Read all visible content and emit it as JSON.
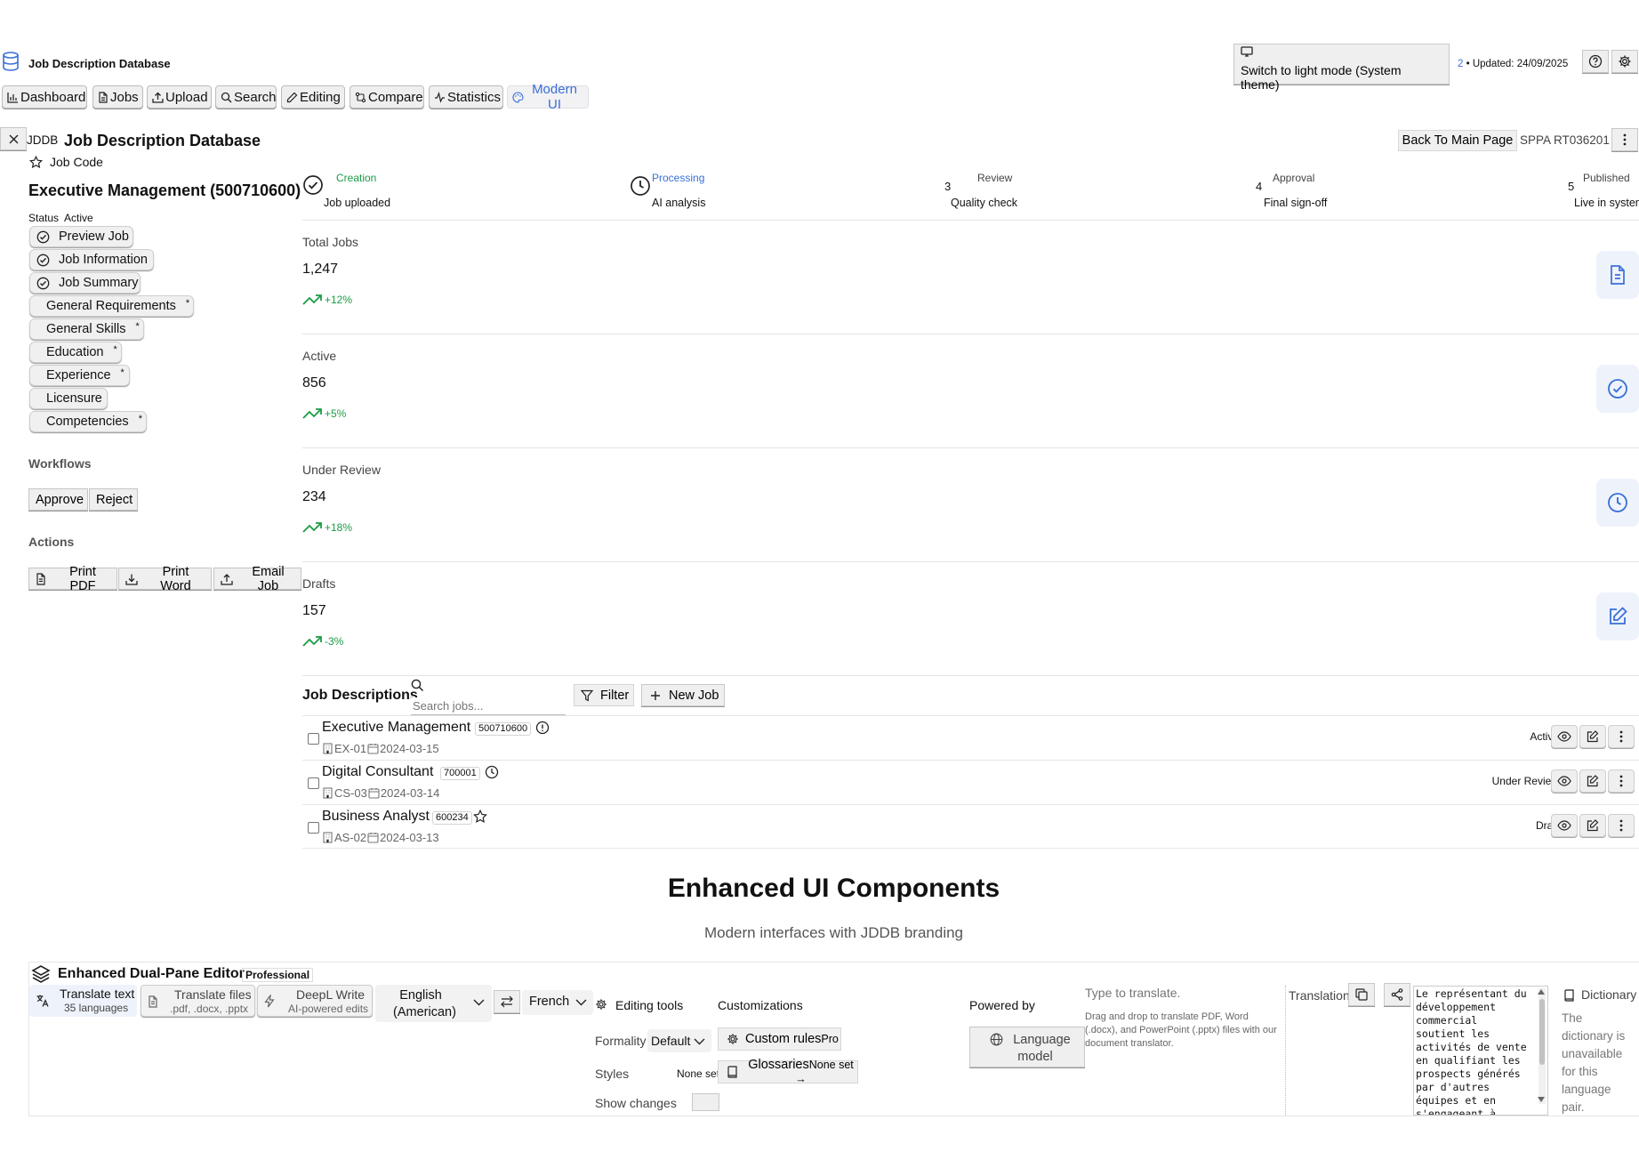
{
  "app": {
    "title": "Job Description Database"
  },
  "topbar": {
    "theme_label": "Switch to light mode (System theme)",
    "update_count": "2",
    "update_text": " • Updated: 24/09/2025"
  },
  "nav": [
    {
      "label": "Dashboard",
      "icon": "bar-chart-icon"
    },
    {
      "label": "Jobs",
      "icon": "file-icon"
    },
    {
      "label": "Upload",
      "icon": "upload-icon"
    },
    {
      "label": "Search",
      "icon": "search-icon"
    },
    {
      "label": "Editing",
      "icon": "pencil-icon"
    },
    {
      "label": "Compare",
      "icon": "compare-icon"
    },
    {
      "label": "Statistics",
      "icon": "activity-icon"
    },
    {
      "label": "Modern UI",
      "icon": "palette-icon"
    }
  ],
  "header": {
    "brand_short": "JDDB",
    "title": "Job Description Database",
    "back_label": "Back To Main Page",
    "ref_code": "SPPA RT036201"
  },
  "sidebar": {
    "job_code_label": "Job Code",
    "job_title": "Executive Management (500710600)",
    "status_label": "Status",
    "status_value": "Active",
    "sections": [
      {
        "label": "Preview Job",
        "checked": true,
        "required": false
      },
      {
        "label": "Job Information",
        "checked": true,
        "required": false
      },
      {
        "label": "Job Summary",
        "checked": true,
        "required": false
      },
      {
        "label": "General Requirements",
        "checked": false,
        "required": true
      },
      {
        "label": "General Skills",
        "checked": false,
        "required": true
      },
      {
        "label": "Education",
        "checked": false,
        "required": true
      },
      {
        "label": "Experience",
        "checked": false,
        "required": true
      },
      {
        "label": "Licensure",
        "checked": false,
        "required": false
      },
      {
        "label": "Competencies",
        "checked": false,
        "required": true
      }
    ],
    "required_mark": "*",
    "workflows_title": "Workflows",
    "approve_label": "Approve",
    "reject_label": "Reject",
    "actions_title": "Actions",
    "print_pdf_label": "Print PDF",
    "print_word_label": "Print Word",
    "email_job_label": "Email Job"
  },
  "steps": [
    {
      "num": "",
      "title": "Creation",
      "subtitle": "Job uploaded",
      "state": "done"
    },
    {
      "num": "",
      "title": "Processing",
      "subtitle": "AI analysis",
      "state": "active"
    },
    {
      "num": "3",
      "title": "Review",
      "subtitle": "Quality check",
      "state": "pending"
    },
    {
      "num": "4",
      "title": "Approval",
      "subtitle": "Final sign-off",
      "state": "pending"
    },
    {
      "num": "5",
      "title": "Published",
      "subtitle": "Live in system",
      "state": "pending"
    }
  ],
  "stats": [
    {
      "label": "Total Jobs",
      "value": "1,247",
      "change": "+12%",
      "icon": "document-icon"
    },
    {
      "label": "Active",
      "value": "856",
      "change": "+5%",
      "icon": "check-circle-icon"
    },
    {
      "label": "Under Review",
      "value": "234",
      "change": "+18%",
      "icon": "clock-icon"
    },
    {
      "label": "Drafts",
      "value": "157",
      "change": "-3%",
      "icon": "edit-icon"
    }
  ],
  "job_list": {
    "title": "Job Descriptions",
    "search_placeholder": "Search jobs...",
    "filter_label": "Filter",
    "new_job_label": "New Job",
    "rows": [
      {
        "name": "Executive Management",
        "code": "500710600",
        "dept": "EX-01",
        "date": "2024-03-15",
        "status": "Active",
        "status_icon": "info-icon"
      },
      {
        "name": "Digital Consultant",
        "code": "700001",
        "dept": "CS-03",
        "date": "2024-03-14",
        "status": "Under Review",
        "status_icon": "clock-icon"
      },
      {
        "name": "Business Analyst",
        "code": "600234",
        "dept": "AS-02",
        "date": "2024-03-13",
        "status": "Draft",
        "status_icon": "star-icon"
      }
    ]
  },
  "enhanced": {
    "title": "Enhanced UI Components",
    "subtitle": "Modern interfaces with JDDB branding"
  },
  "editor": {
    "title": "Enhanced Dual-Pane Editor",
    "badge": "Professional",
    "translate_text_label": "Translate text",
    "translate_text_sub": "35 languages",
    "translate_files_label": "Translate files",
    "translate_files_sub": ".pdf, .docx, .pptx",
    "deepl_label": "DeepL Write",
    "deepl_sub": "AI-powered edits",
    "source_lang": "English\n(American)",
    "target_lang": "French",
    "editing_tools_label": "Editing tools",
    "customizations_label": "Customizations",
    "powered_by_label": "Powered by",
    "language_model_label": "Language model",
    "formality_label": "Formality",
    "formality_value": "Default",
    "custom_rules_label": "Custom rules",
    "custom_rules_badge": "Pro",
    "styles_label": "Styles",
    "styles_value": "None set",
    "glossaries_label": "Glossaries",
    "glossaries_value": "None set →",
    "show_changes_label": "Show changes",
    "source_placeholder": "Type to translate.",
    "drop_hint": "Drag and drop to translate PDF, Word (.docx), and PowerPoint (.pptx) files with our document translator.",
    "translation_label": "Translation",
    "translation_text": "Le représentant du développement commercial soutient les activités de vente en qualifiant les prospects générés par d'autres équipes et en s'engageant à développer ces",
    "dictionary_label": "Dictionary",
    "dictionary_text": "The dictionary is unavailable for this language pair."
  },
  "colors": {
    "accent": "#3a6fd8",
    "trend_up": "#1b9c46",
    "icon_bg": "#eef3fb"
  }
}
